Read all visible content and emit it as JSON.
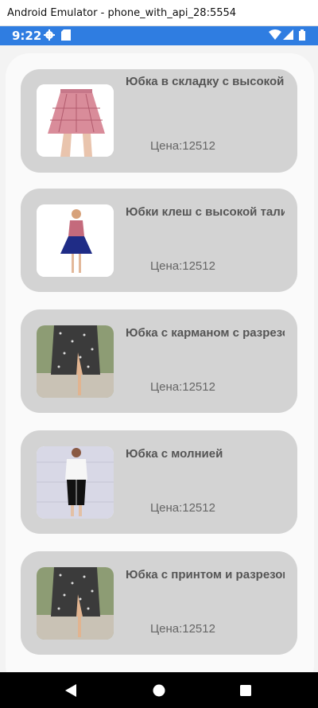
{
  "window": {
    "title": "Android Emulator - phone_with_api_28:5554"
  },
  "status_bar": {
    "time": "9:22"
  },
  "products": [
    {
      "title": "Юбка в складку с высокой талией",
      "price": "Цена:12512"
    },
    {
      "title": "Юбки клеш с высокой талией",
      "price": "Цена:12512"
    },
    {
      "title": "Юбка с карманом с разрезом",
      "price": "Цена:12512"
    },
    {
      "title": "Юбка с молнией",
      "price": "Цена:12512"
    },
    {
      "title": "Юбка с принтом и разрезом",
      "price": "Цена:12512"
    }
  ],
  "colors": {
    "status_bar": "#2f7de1",
    "card": "#d3d3d3",
    "nav_bar": "#000000"
  },
  "icons": [
    "gear-icon",
    "sim-card-icon",
    "wifi-icon",
    "signal-icon",
    "battery-icon",
    "back-icon",
    "home-icon",
    "recents-icon"
  ]
}
